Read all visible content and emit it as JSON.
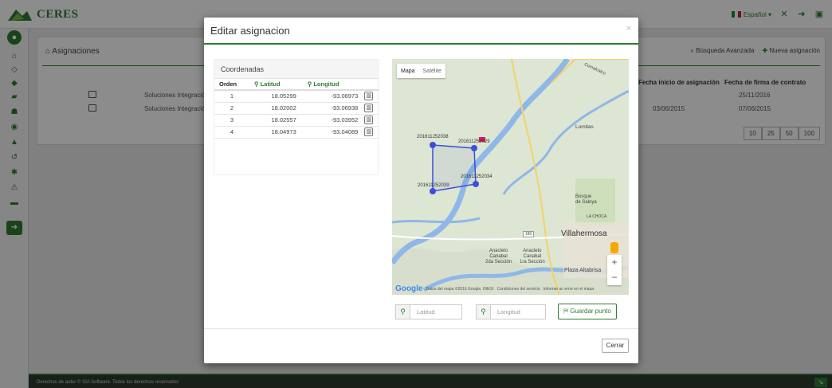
{
  "app": {
    "brand": "CERES",
    "language": "Español",
    "icons": [
      "user-icon",
      "home-icon",
      "diamond-icon",
      "tag-icon",
      "book-icon",
      "users-icon",
      "globe-icon",
      "person-icon",
      "history-icon",
      "cogs-icon",
      "warning-icon",
      "card-icon",
      "arrow-circle-icon"
    ]
  },
  "page": {
    "breadcrumb": "Asignaciones",
    "advanced_search": "Búsqueda Avanzada",
    "new_assignment": "Nueva asignación",
    "columns": {
      "start_date": "Fecha inicio de asignación",
      "contract_date": "Fecha de firma de contrato"
    },
    "rows": [
      {
        "company": "Soluciones Integració",
        "start_date": "",
        "contract_date": "25/11/2016"
      },
      {
        "company": "Soluciones Integració",
        "start_date": "03/06/2015",
        "contract_date": "07/06/2015"
      }
    ],
    "page_sizes": [
      "10",
      "25",
      "50",
      "100"
    ]
  },
  "footer": {
    "text": "Derechos de autor © SIA Software. Todos los derechos reservados"
  },
  "modal": {
    "title": "Editar asignacion",
    "close": "×",
    "coords_title": "Coordenadas",
    "headers": {
      "orden": "Orden",
      "latitud": "Latitud",
      "longitud": "Longitud"
    },
    "coordinates": [
      {
        "orden": "1",
        "latitud": "18.05299",
        "longitud": "-93.06973"
      },
      {
        "orden": "2",
        "latitud": "18.02002",
        "longitud": "-93.06938"
      },
      {
        "orden": "3",
        "latitud": "18.02557",
        "longitud": "-93.03952"
      },
      {
        "orden": "4",
        "latitud": "18.04973",
        "longitud": "-93.04089"
      }
    ],
    "map": {
      "type_map": "Mapa",
      "type_satellite": "Satélite",
      "point_labels": [
        "201611252038",
        "201611252029",
        "201611252034",
        "201611252039"
      ],
      "places": {
        "lomitas": "Lomitas",
        "bosque": "Bosque\nde Saloya",
        "la_choca": "LA CHOCA",
        "villahermosa": "Villahermosa",
        "anacleto2": "Anacleto\nCanabal\n2da Sección",
        "anacleto1": "Anacleto\nCanabal\n1ra Sección",
        "plaza": "Plaza Altabrisa",
        "road": "180",
        "river": "Comalcalco"
      },
      "google": "Google",
      "attribution": "Datos del mapa ©2016 Google, INEGI",
      "terms": "Condiciones del servicio",
      "report": "Informar un error en el mapa",
      "zoom_in": "+",
      "zoom_out": "−"
    },
    "lat_placeholder": "Latitud",
    "lon_placeholder": "Longitud",
    "save_point": "Guardar punto",
    "cerrar": "Cerrar",
    "colors": {
      "accent": "#2e7d32",
      "polygon": "#3b4fd8",
      "marker": "#d81b60"
    }
  }
}
